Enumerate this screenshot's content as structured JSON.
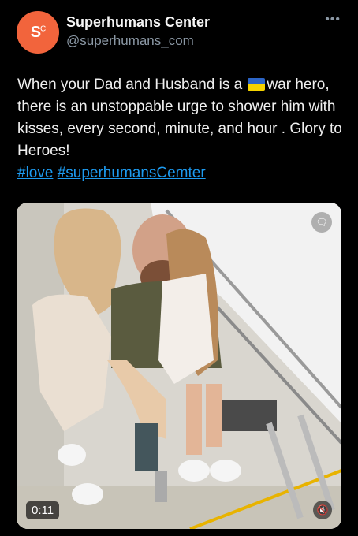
{
  "author": {
    "name": "Superhumans Center",
    "handle": "@superhumans_com",
    "avatar_text": "S",
    "avatar_sup": "C",
    "avatar_color": "#f2643c"
  },
  "more_icon": "more-icon",
  "tweet": {
    "text_before_flag": "When your Dad and Husband is a ",
    "text_after_flag": "war hero, there is an unstoppable urge to shower him with kisses, every second, minute, and hour . Glory to Heroes!",
    "hashtags": [
      "#love",
      "#superhumansCemter"
    ],
    "flag_colors": [
      "#2c65c7",
      "#f5d300"
    ]
  },
  "media": {
    "duration": "0:11",
    "mute_icon": "speaker-muted-icon",
    "captions_icon": "captions-off-icon"
  },
  "colors": {
    "background": "#000000",
    "link": "#1d9bf0"
  }
}
